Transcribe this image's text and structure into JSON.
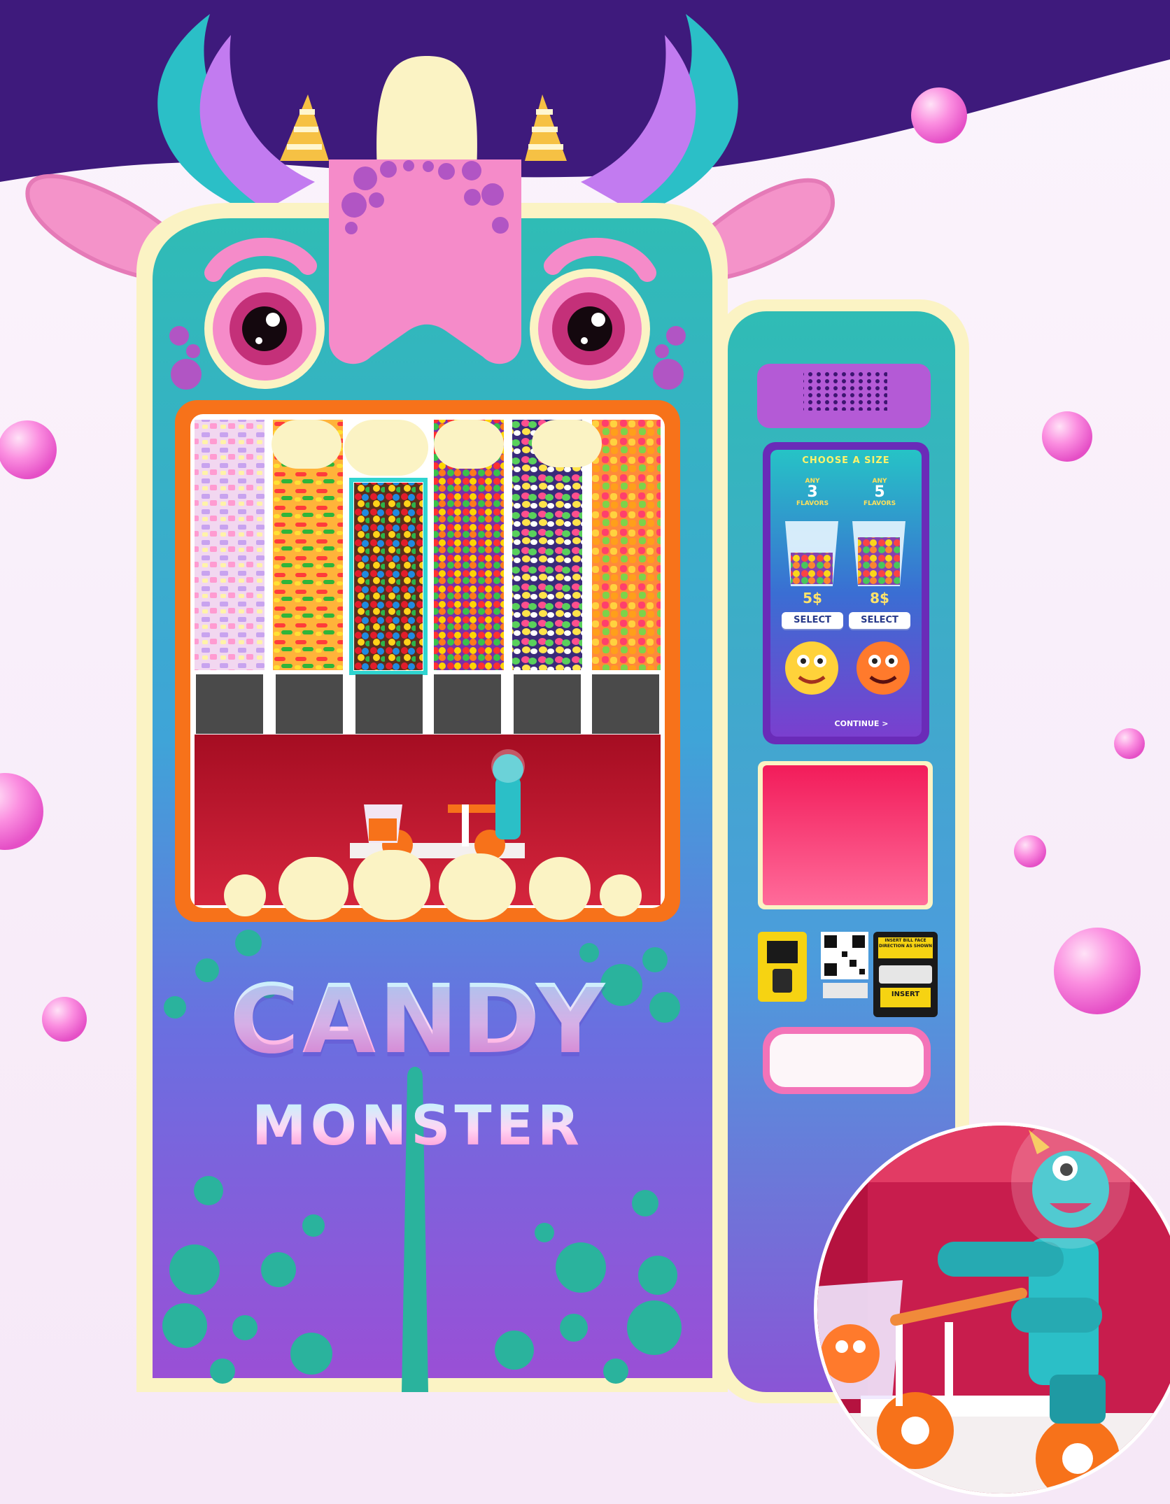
{
  "brand": {
    "line1": "CANDY",
    "line2": "MONSTER"
  },
  "screen": {
    "header": "CHOOSE A SIZE",
    "options": [
      {
        "prefix": "ANY",
        "count": "3",
        "suffix": "FLAVORS",
        "price": "5$",
        "button": "SELECT"
      },
      {
        "prefix": "ANY",
        "count": "5",
        "suffix": "FLAVORS",
        "price": "8$",
        "button": "SELECT"
      }
    ],
    "continue_label": "CONTINUE >"
  },
  "bill_acceptor": {
    "top_text": "INSERT BILL FACE DIRECTION AS SHOWN",
    "slot_text": "INSERT"
  },
  "colors": {
    "header_purple": "#3d1a7a",
    "teal": "#2bb8b4",
    "machine_purple": "#8a47d9",
    "pink": "#f48ccf",
    "cream": "#fbf3c4",
    "red_chamber": "#c0152f",
    "orange_frame": "#f7721a"
  },
  "icons": [
    "speaker-grille-icon",
    "qr-code-icon",
    "card-reader-icon",
    "bill-acceptor-icon"
  ]
}
